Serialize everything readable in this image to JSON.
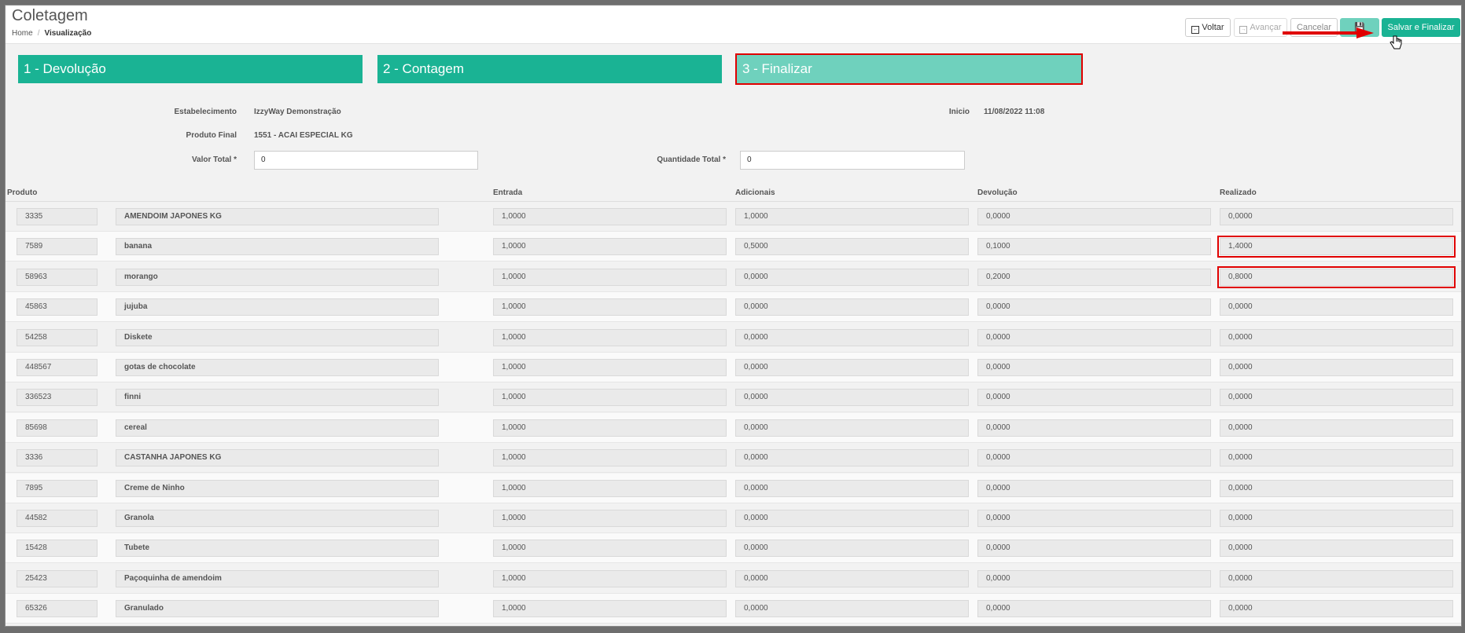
{
  "page": {
    "title": "Coletagem",
    "breadcrumb": [
      "Home",
      "Visualização"
    ]
  },
  "toolbar": {
    "voltar": "Voltar",
    "avancar": "Avançar",
    "cancelar": "Cancelar",
    "salvar_finalizar": "Salvar e Finalizar"
  },
  "steps": [
    "1 - Devolução",
    "2 - Contagem",
    "3 - Finalizar"
  ],
  "info": {
    "estabelecimento_label": "Estabelecimento",
    "estabelecimento_value": "IzzyWay Demonstração",
    "inicio_label": "Inicio",
    "inicio_value": "11/08/2022 11:08",
    "produto_final_label": "Produto Final",
    "produto_final_value": "1551 - ACAI ESPECIAL KG",
    "valor_total_label": "Valor Total *",
    "valor_total_value": "0",
    "quantidade_total_label": "Quantidade Total *",
    "quantidade_total_value": "0"
  },
  "table": {
    "headers": [
      "Produto",
      "Entrada",
      "Adicionais",
      "Devolução",
      "Realizado"
    ],
    "rows": [
      {
        "code": "3335",
        "name": "AMENDOIM JAPONES KG",
        "entrada": "1,0000",
        "adicionais": "1,0000",
        "devolucao": "0,0000",
        "realizado": "0,0000"
      },
      {
        "code": "7589",
        "name": "banana",
        "entrada": "1,0000",
        "adicionais": "0,5000",
        "devolucao": "0,1000",
        "realizado": "1,4000"
      },
      {
        "code": "58963",
        "name": "morango",
        "entrada": "1,0000",
        "adicionais": "0,0000",
        "devolucao": "0,2000",
        "realizado": "0,8000"
      },
      {
        "code": "45863",
        "name": "jujuba",
        "entrada": "1,0000",
        "adicionais": "0,0000",
        "devolucao": "0,0000",
        "realizado": "0,0000"
      },
      {
        "code": "54258",
        "name": "Diskete",
        "entrada": "1,0000",
        "adicionais": "0,0000",
        "devolucao": "0,0000",
        "realizado": "0,0000"
      },
      {
        "code": "448567",
        "name": "gotas de chocolate",
        "entrada": "1,0000",
        "adicionais": "0,0000",
        "devolucao": "0,0000",
        "realizado": "0,0000"
      },
      {
        "code": "336523",
        "name": "finni",
        "entrada": "1,0000",
        "adicionais": "0,0000",
        "devolucao": "0,0000",
        "realizado": "0,0000"
      },
      {
        "code": "85698",
        "name": "cereal",
        "entrada": "1,0000",
        "adicionais": "0,0000",
        "devolucao": "0,0000",
        "realizado": "0,0000"
      },
      {
        "code": "3336",
        "name": "CASTANHA JAPONES KG",
        "entrada": "1,0000",
        "adicionais": "0,0000",
        "devolucao": "0,0000",
        "realizado": "0,0000"
      },
      {
        "code": "7895",
        "name": "Creme de Ninho",
        "entrada": "1,0000",
        "adicionais": "0,0000",
        "devolucao": "0,0000",
        "realizado": "0,0000"
      },
      {
        "code": "44582",
        "name": "Granola",
        "entrada": "1,0000",
        "adicionais": "0,0000",
        "devolucao": "0,0000",
        "realizado": "0,0000"
      },
      {
        "code": "15428",
        "name": "Tubete",
        "entrada": "1,0000",
        "adicionais": "0,0000",
        "devolucao": "0,0000",
        "realizado": "0,0000"
      },
      {
        "code": "25423",
        "name": "Paçoquinha de amendoim",
        "entrada": "1,0000",
        "adicionais": "0,0000",
        "devolucao": "0,0000",
        "realizado": "0,0000"
      },
      {
        "code": "65326",
        "name": "Granulado",
        "entrada": "1,0000",
        "adicionais": "0,0000",
        "devolucao": "0,0000",
        "realizado": "0,0000"
      }
    ]
  },
  "colors": {
    "accent": "#1ab394",
    "accent_light": "#6fd1bd",
    "highlight": "#e00000"
  }
}
